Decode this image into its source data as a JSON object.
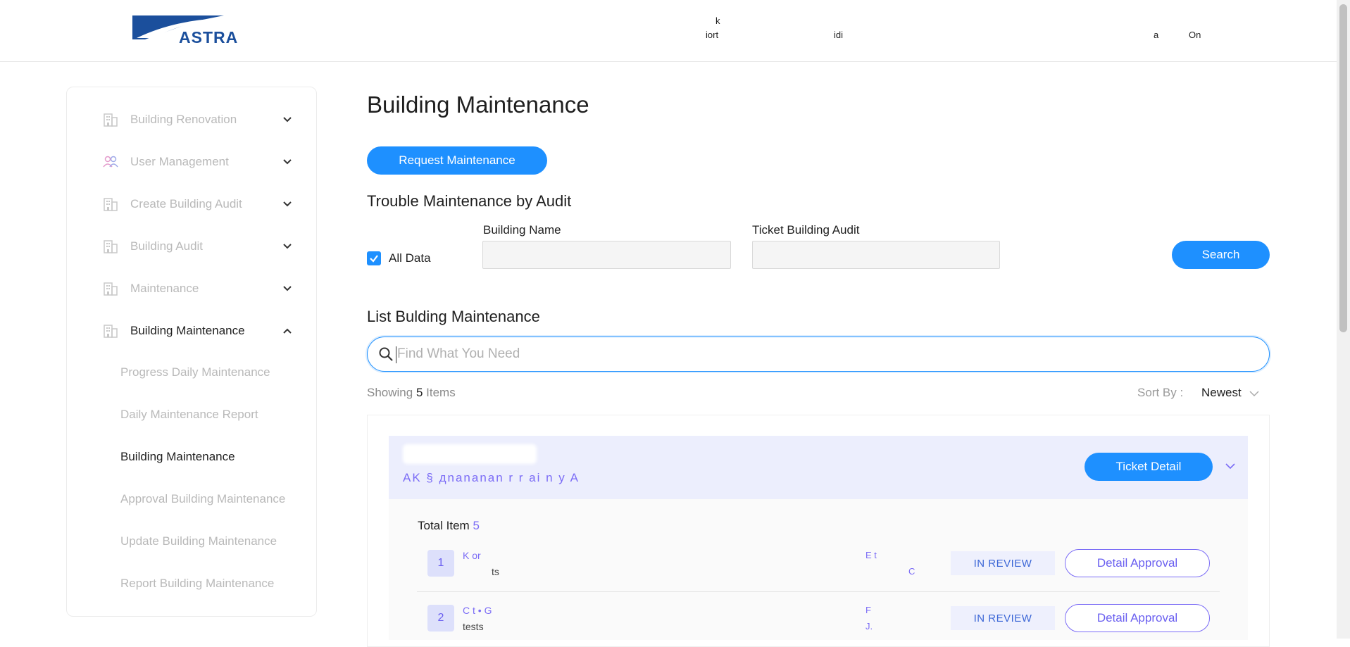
{
  "header": {
    "logo_text": "ASTRA",
    "nav_fragments": [
      "k",
      "iort",
      "idi",
      "a",
      "On"
    ]
  },
  "sidebar": {
    "items": [
      {
        "label": "Building Renovation",
        "icon": "building-icon",
        "expanded": false
      },
      {
        "label": "User Management",
        "icon": "users-icon",
        "expanded": false
      },
      {
        "label": "Create Building Audit",
        "icon": "building-icon",
        "expanded": false
      },
      {
        "label": "Building Audit",
        "icon": "building-icon",
        "expanded": false
      },
      {
        "label": "Maintenance",
        "icon": "building-icon",
        "expanded": false
      },
      {
        "label": "Building Maintenance",
        "icon": "building-icon",
        "expanded": true
      }
    ],
    "sub_items": [
      {
        "label": "Progress Daily Maintenance"
      },
      {
        "label": "Daily Maintenance Report"
      },
      {
        "label": "Building Maintenance",
        "active": true
      },
      {
        "label": "Approval Building Maintenance"
      },
      {
        "label": "Update Building Maintenance"
      },
      {
        "label": "Report Building Maintenance"
      }
    ]
  },
  "main": {
    "title": "Building Maintenance",
    "request_button": "Request Maintenance",
    "audit_section": {
      "title": "Trouble Maintenance by Audit",
      "all_data_label": "All Data",
      "all_data_checked": true,
      "building_name_label": "Building Name",
      "building_name_value": "",
      "ticket_label": "Ticket Building Audit",
      "ticket_value": "",
      "search_button": "Search"
    },
    "list_section": {
      "title": "List Bulding Maintenance",
      "search_placeholder": "Find What You Need",
      "showing_prefix": "Showing",
      "showing_count": "5",
      "showing_suffix": "Items",
      "sort_label": "Sort By :",
      "sort_value": "Newest"
    },
    "ticket": {
      "title_fragment": "AK     §        дnananan r   r   ai n y A",
      "detail_button": "Ticket Detail",
      "total_label": "Total Item",
      "total_count": "5",
      "rows": [
        {
          "num": "1",
          "name": "K             or",
          "sub": "ts",
          "meta_top": "E          t",
          "meta_bottom": "C",
          "status": "IN REVIEW",
          "action": "Detail Approval"
        },
        {
          "num": "2",
          "name": "C     t  •  G",
          "sub": "tests",
          "meta_top": "F",
          "meta_bottom": "J.",
          "status": "IN REVIEW",
          "action": "Detail Approval"
        }
      ]
    }
  },
  "colors": {
    "primary": "#1e90ff",
    "accent": "#7b6cf6",
    "status_text": "#3b66d6"
  }
}
